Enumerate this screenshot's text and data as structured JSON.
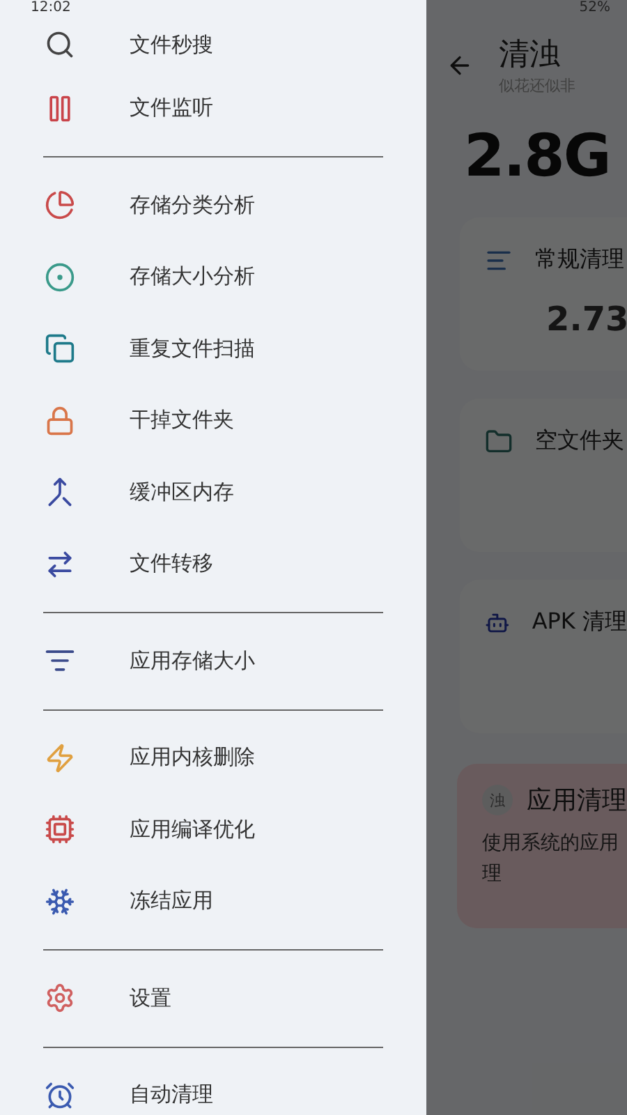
{
  "status_bar": {
    "time": "12:02",
    "battery": "52%"
  },
  "drawer": {
    "sections": [
      [
        {
          "label": "文件秒搜"
        },
        {
          "label": "文件监听"
        }
      ],
      [
        {
          "label": "存储分类分析"
        },
        {
          "label": "存储大小分析"
        },
        {
          "label": "重复文件扫描"
        },
        {
          "label": "干掉文件夹"
        },
        {
          "label": "缓冲区内存"
        },
        {
          "label": "文件转移"
        }
      ],
      [
        {
          "label": "应用存储大小"
        }
      ],
      [
        {
          "label": "应用内核删除"
        },
        {
          "label": "应用编译优化"
        },
        {
          "label": "冻结应用"
        }
      ],
      [
        {
          "label": "设置"
        }
      ],
      [
        {
          "label": "自动清理"
        }
      ]
    ]
  },
  "page": {
    "title": "清浊",
    "subtitle": "似花还似非",
    "total": "2.8G",
    "cards": [
      {
        "kind": "category",
        "title": "常规清理",
        "value": "2.73"
      },
      {
        "kind": "category",
        "title": "空文件夹"
      },
      {
        "kind": "category",
        "title": "APK 清理"
      },
      {
        "kind": "promo",
        "badge": "浊",
        "title": "应用清理",
        "lines": [
          "使用系统的应用",
          "理"
        ]
      }
    ]
  }
}
